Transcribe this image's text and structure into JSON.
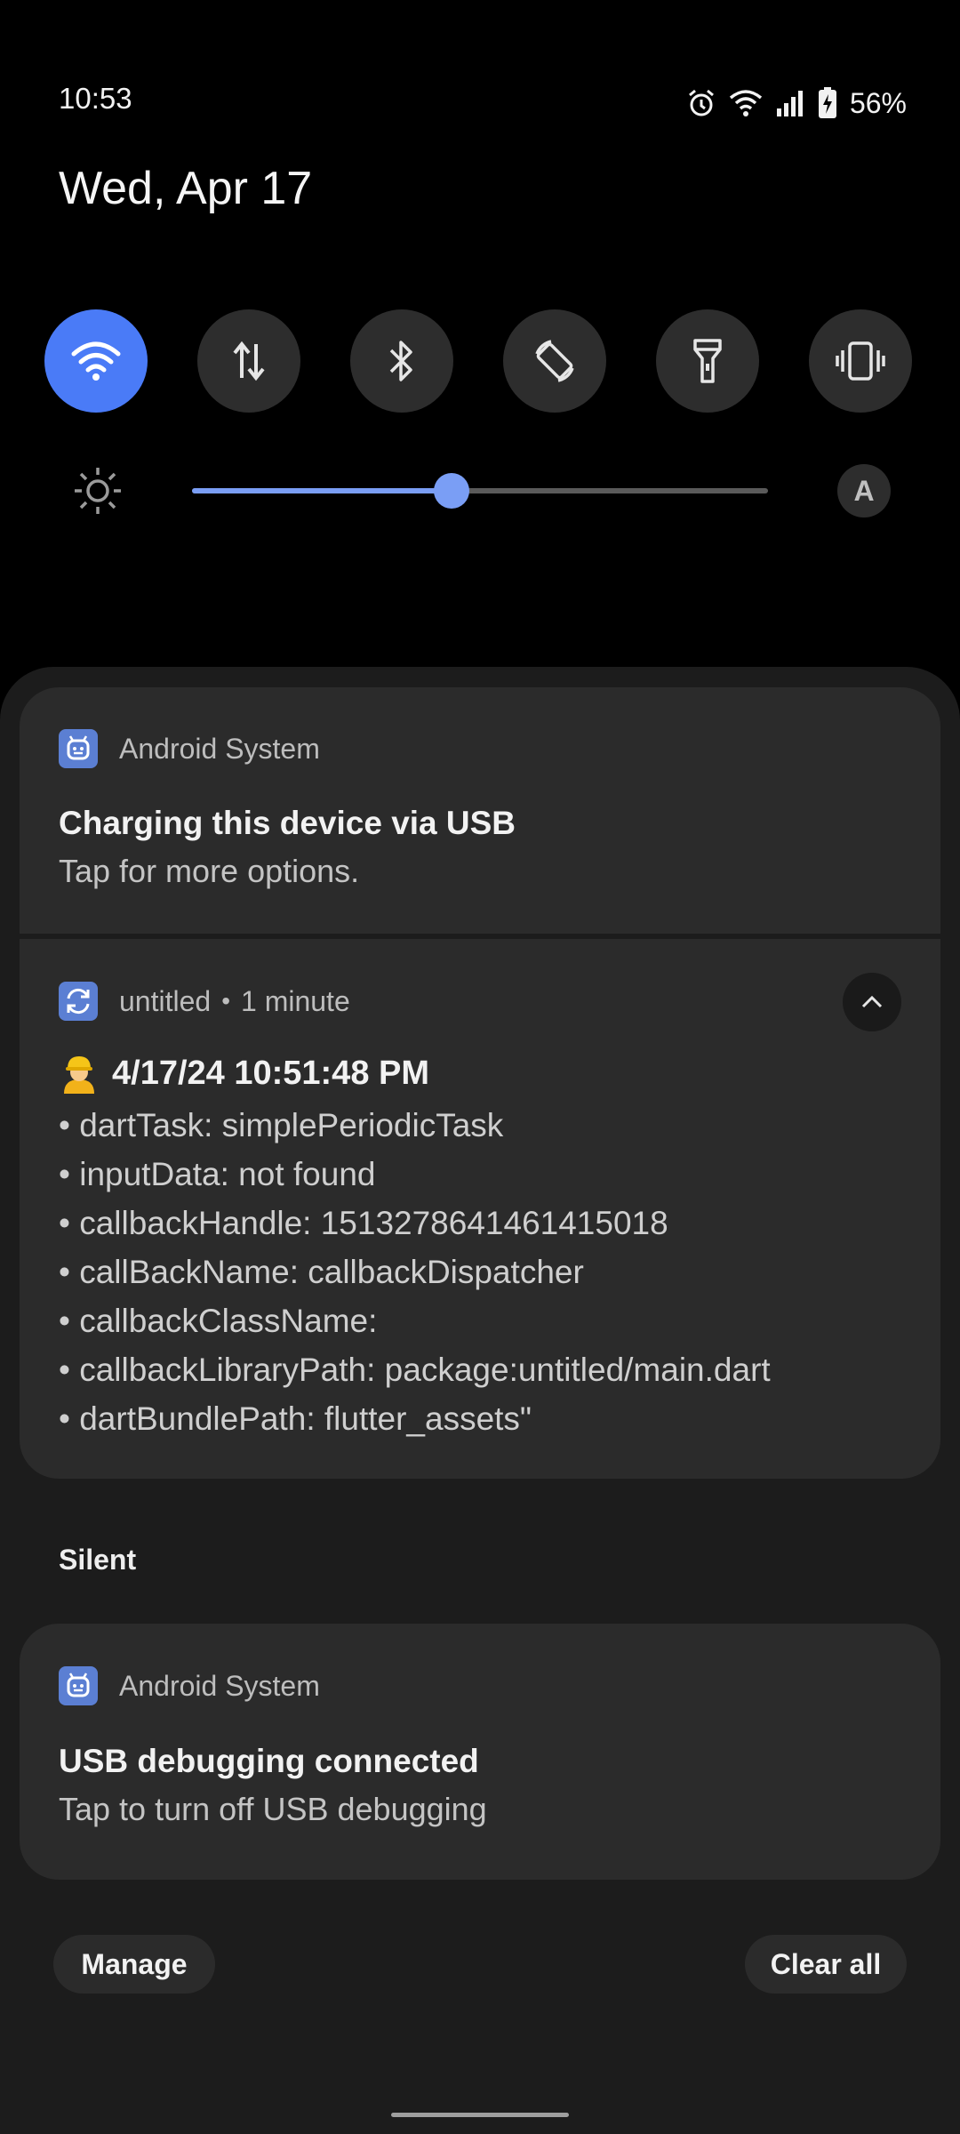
{
  "status_bar": {
    "time": "10:53",
    "battery_percent": "56%",
    "icons": [
      "alarm-icon",
      "wifi-icon",
      "signal-icon",
      "battery-charging-icon"
    ]
  },
  "header": {
    "date": "Wed, Apr 17"
  },
  "quick_tiles": [
    {
      "name": "wifi",
      "icon": "wifi-icon",
      "active": true
    },
    {
      "name": "mobile-data",
      "icon": "data-arrows-icon",
      "active": false
    },
    {
      "name": "bluetooth",
      "icon": "bluetooth-icon",
      "active": false
    },
    {
      "name": "auto-rotate",
      "icon": "rotate-icon",
      "active": false
    },
    {
      "name": "flashlight",
      "icon": "flashlight-icon",
      "active": false
    },
    {
      "name": "vibrate",
      "icon": "vibrate-icon",
      "active": false
    }
  ],
  "brightness": {
    "level_fraction": 0.45,
    "auto_label": "A",
    "accent": "#7a9ef5"
  },
  "notifications": [
    {
      "app": "Android System",
      "title": "Charging this device via USB",
      "text": "Tap for more options."
    },
    {
      "app": "untitled",
      "dot": "•",
      "time": "1 minute",
      "title": "4/17/24 10:51:48 PM",
      "lines": [
        "• dartTask: simplePeriodicTask",
        "• inputData: not found",
        "• callbackHandle: 1513278641461415018",
        "• callBackName: callbackDispatcher",
        "• callbackClassName:",
        "• callbackLibraryPath: package:untitled/main.dart",
        "• dartBundlePath: flutter_assets\""
      ]
    }
  ],
  "silent": {
    "label": "Silent",
    "notification": {
      "app": "Android System",
      "title": "USB debugging connected",
      "text": "Tap to turn off USB debugging"
    }
  },
  "footer": {
    "manage_label": "Manage",
    "clear_label": "Clear all"
  },
  "colors": {
    "accent_blue": "#4a7bf7",
    "card_bg": "#2b2b2b",
    "panel_bg": "#1c1c1c"
  }
}
